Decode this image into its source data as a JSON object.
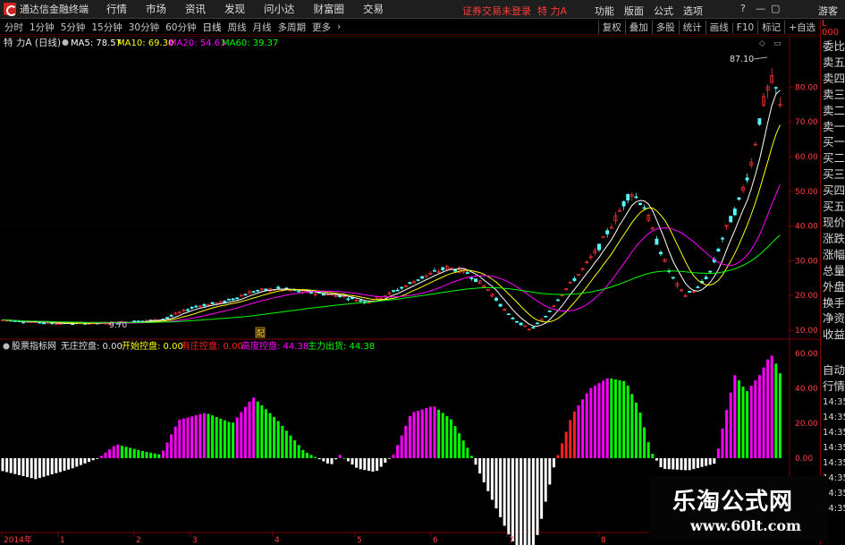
{
  "menubar": {
    "app_title": "通达信金融终端",
    "items": [
      "行情",
      "市场",
      "资讯",
      "发现",
      "问小达",
      "财富圈",
      "交易"
    ],
    "login_status": "证券交易未登录",
    "stock": "特 力A",
    "right_items": [
      "功能",
      "版面",
      "公式",
      "选项"
    ],
    "guest": "游客"
  },
  "periods": [
    "分时",
    "1分钟",
    "5分钟",
    "15分钟",
    "30分钟",
    "60分钟",
    "日线",
    "周线",
    "月线",
    "多周期",
    "更多"
  ],
  "active_period": "日线",
  "tools": [
    "复权",
    "叠加",
    "多股",
    "统计",
    "画线",
    "F10",
    "标记",
    "+自选"
  ],
  "main_chart": {
    "title": "特 力A (日线)",
    "ma_labels": [
      {
        "text": "MA5: 78.57",
        "color": "#ffffff"
      },
      {
        "text": "MA10: 69.30",
        "color": "#ffff00"
      },
      {
        "text": "MA20: 54.63",
        "color": "#ff00ff"
      },
      {
        "text": "MA60: 39.37",
        "color": "#00ff00"
      }
    ],
    "y_ticks": [
      "80.00",
      "70.00",
      "60.00",
      "50.00",
      "40.00",
      "30.00",
      "20.00",
      "10.00"
    ],
    "high_marker": "87.10",
    "low_marker": "9.70",
    "event_marker": "配"
  },
  "indicator": {
    "name": "股票指标网",
    "labels": [
      {
        "text": "无庄控盘: 0.00",
        "color": "#e0e0e0"
      },
      {
        "text": "开始控盘: 0.00",
        "color": "#ffff00"
      },
      {
        "text": "有庄控盘: 0.00",
        "color": "#ff2020"
      },
      {
        "text": "高度控盘: 44.38",
        "color": "#ff00ff"
      },
      {
        "text": "主力出货: 44.38",
        "color": "#00ff00"
      }
    ],
    "y_ticks": [
      "60.00",
      "40.00",
      "20.00",
      "0.00"
    ]
  },
  "x_axis": {
    "labels": [
      "2014年",
      "1",
      "2",
      "3",
      "4",
      "5",
      "6",
      "7",
      "8"
    ]
  },
  "right_panel": {
    "top": "L 000",
    "items": [
      "委比",
      "卖五",
      "卖四",
      "卖三",
      "卖二",
      "卖一",
      "买一",
      "买二",
      "买三",
      "买四",
      "买五",
      "现价",
      "涨跌",
      "涨幅",
      "总量",
      "外盘",
      "换手",
      "净资",
      "收益"
    ],
    "lower_items": [
      "自动",
      "行情",
      "14:35",
      "14:35",
      "14:35",
      "14:35",
      "14:35",
      "14:35",
      "14:35",
      "14:35"
    ]
  },
  "watermark": {
    "title": "乐淘公式网",
    "url": "www.60lt.com"
  }
}
